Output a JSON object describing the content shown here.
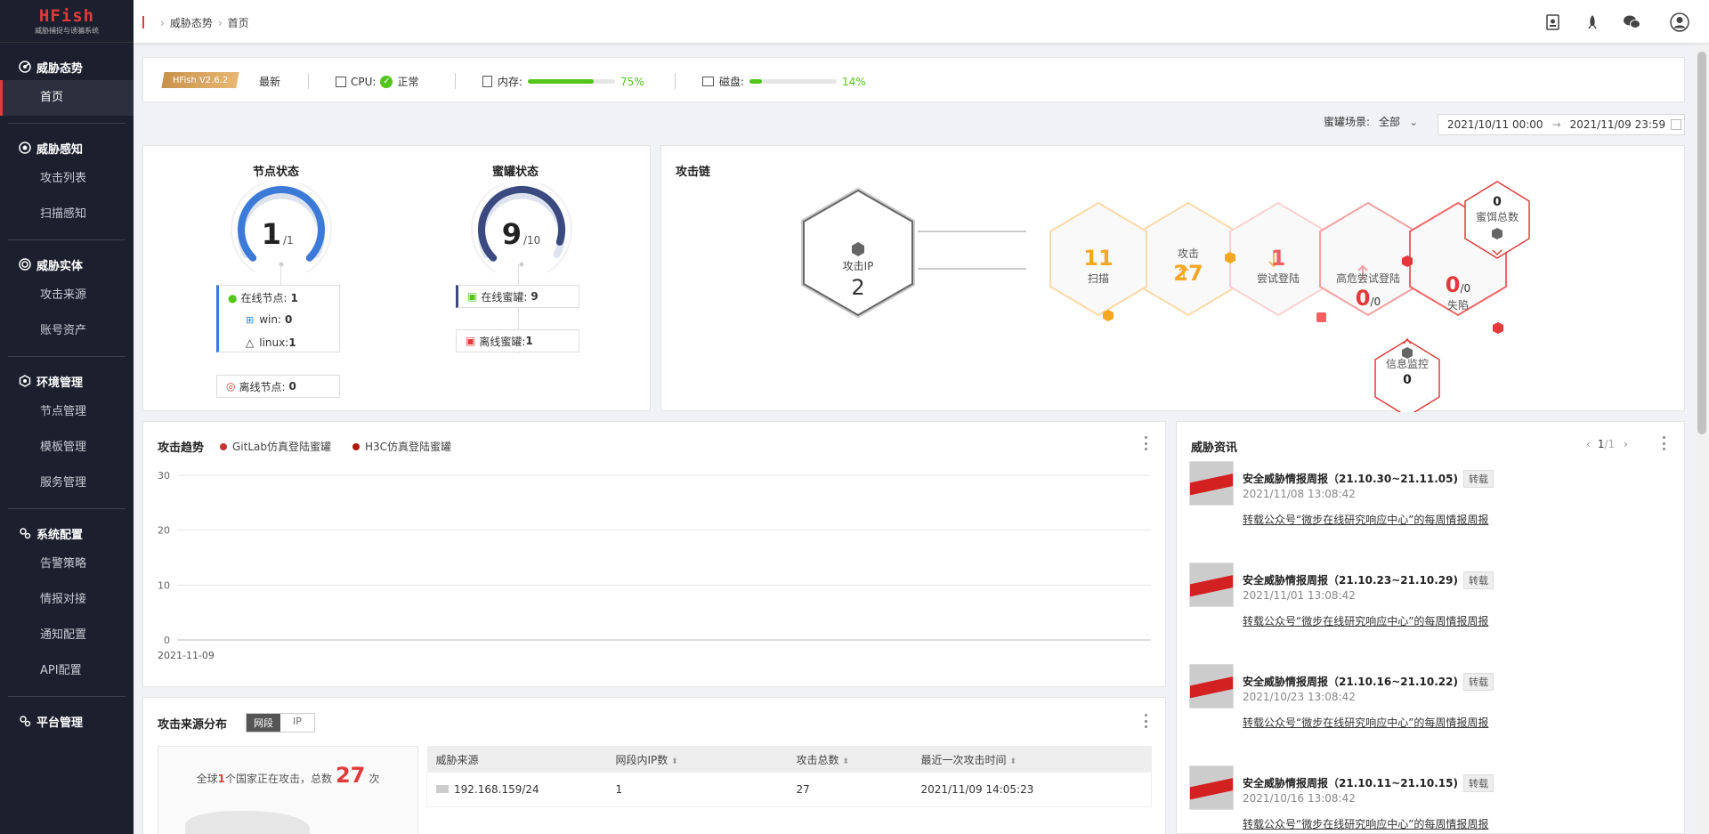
{
  "app": {
    "logo": "HFish",
    "subtitle": "威胁捕捉与诱骗系统"
  },
  "sidebar": {
    "groups": [
      {
        "title": "威胁态势",
        "icon": "radar-icon",
        "items": [
          "首页"
        ]
      },
      {
        "title": "威胁感知",
        "icon": "eye-icon",
        "items": [
          "攻击列表",
          "扫描感知"
        ]
      },
      {
        "title": "威胁实体",
        "icon": "target-icon",
        "items": [
          "攻击来源",
          "账号资产"
        ]
      },
      {
        "title": "环境管理",
        "icon": "shield-icon",
        "items": [
          "节点管理",
          "模板管理",
          "服务管理"
        ]
      },
      {
        "title": "系统配置",
        "icon": "gears-icon",
        "items": [
          "告警策略",
          "情报对接",
          "通知配置",
          "API配置"
        ]
      },
      {
        "title": "平台管理",
        "icon": "gears-icon",
        "items": []
      }
    ]
  },
  "breadcrumb": {
    "parent": "威胁态势",
    "current": "首页"
  },
  "topbar": {
    "icons": [
      "docs-icon",
      "rocket-icon",
      "wechat-icon",
      "user-avatar-icon"
    ]
  },
  "sysbar": {
    "version": "HFish V2.6.2",
    "latest": "最新",
    "cpu_label": "CPU:",
    "cpu_status": "正常",
    "mem_label": "内存:",
    "mem_pct": "75%",
    "mem_value": 0.75,
    "disk_label": "磁盘:",
    "disk_pct": "14%",
    "disk_value": 0.14
  },
  "filter": {
    "scene_label": "蜜罐场景:",
    "scene_value": "全部",
    "date_from": "2021/10/11 00:00",
    "date_to": "2021/11/09 23:59"
  },
  "node_status": {
    "title": "节点状态",
    "value": "1",
    "total": "/1",
    "gauge": 1.0,
    "online_label": "在线节点:",
    "online": "1",
    "win_label": "win:",
    "win": "0",
    "linux_label": "linux:",
    "linux": "1",
    "offline_label": "离线节点:",
    "offline": "0"
  },
  "honeypot_status": {
    "title": "蜜罐状态",
    "value": "9",
    "total": "/10",
    "gauge": 0.9,
    "online_label": "在线蜜罐:",
    "online": "9",
    "offline_label": "离线蜜罐:",
    "offline": "1"
  },
  "attack_chain": {
    "title": "攻击链",
    "ip_label": "攻击IP",
    "ip_count": "2",
    "scan_count": "11",
    "scan_label": "扫描",
    "attack_label": "攻击",
    "attack_count": "27",
    "try_count": "1",
    "try_label": "尝试登陆",
    "high_label": "高危尝试登陆",
    "high_count": "0",
    "high_total": "/0",
    "fall_count": "0",
    "fall_total": "/0",
    "fall_label": "失陷",
    "bait_count": "0",
    "bait_label": "蜜饵总数",
    "monitor_label": "信息监控",
    "monitor_count": "0"
  },
  "trend": {
    "title": "攻击趋势",
    "legend": [
      "GitLab仿真登陆蜜罐",
      "H3C仿真登陆蜜罐"
    ],
    "legend_colors": [
      "#c23531",
      "#b0190a"
    ],
    "yticks": [
      "30",
      "20",
      "10",
      "0"
    ],
    "xlabel": "2021-11-09"
  },
  "chart_data": {
    "type": "line",
    "categories": [
      "2021-11-09"
    ],
    "series": [
      {
        "name": "GitLab仿真登陆蜜罐",
        "values": [
          0
        ]
      },
      {
        "name": "H3C仿真登陆蜜罐",
        "values": [
          0
        ]
      }
    ],
    "ylim": [
      0,
      30
    ]
  },
  "news": {
    "title": "威胁资讯",
    "page": "1",
    "pages": "/1",
    "tag": "转载",
    "link": "转载公众号“微步在线研究响应中心”的每周情报周报",
    "items": [
      {
        "title": "安全威胁情报周报（21.10.30~21.11.05)",
        "date": "2021/11/08 13:08:42"
      },
      {
        "title": "安全威胁情报周报（21.10.23~21.10.29)",
        "date": "2021/11/01 13:08:42"
      },
      {
        "title": "安全威胁情报周报（21.10.16~21.10.22)",
        "date": "2021/10/23 13:08:42"
      },
      {
        "title": "安全威胁情报周报（21.10.11~21.10.15)",
        "date": "2021/10/16 13:08:42"
      }
    ]
  },
  "source": {
    "title": "攻击来源分布",
    "tabs": [
      "网段",
      "IP"
    ],
    "summary_pre": "全球",
    "countries": "1",
    "summary_mid": "个国家正在攻击，总数",
    "total": "27",
    "summary_post": "次",
    "columns": [
      "威胁来源",
      "网段内IP数",
      "攻击总数",
      "最近一次攻击时间"
    ],
    "rows": [
      {
        "source": "192.168.159/24",
        "ips": "1",
        "count": "27",
        "time": "2021/11/09 14:05:23"
      }
    ]
  }
}
